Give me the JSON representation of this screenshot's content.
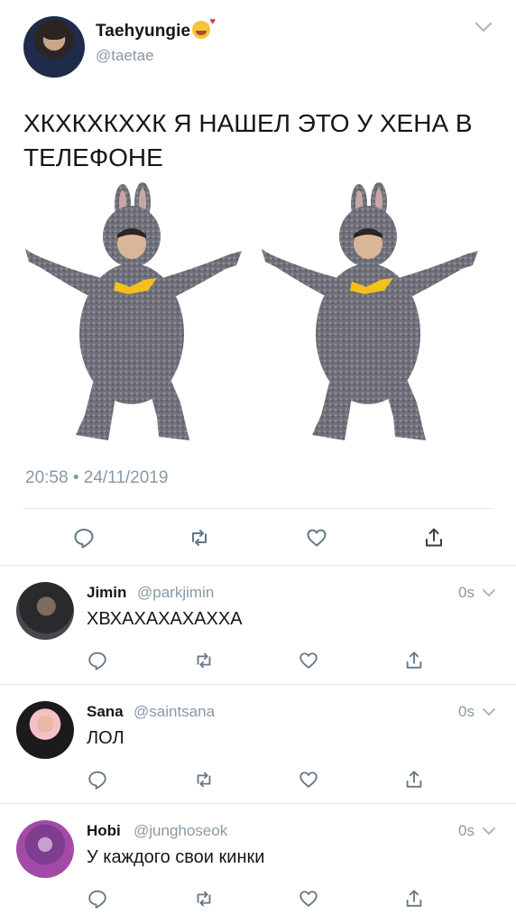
{
  "main_tweet": {
    "display_name": "Taehyungie",
    "emoji_icon": "smiling-face-with-hearts-icon",
    "handle": "@taetae",
    "text": "ХКХКХКХХК Я НАШЕЛ ЭТО У ХЕНА В ТЕЛЕФОНЕ",
    "timestamp": "20:58 • 24/11/2019",
    "media_description_icon": "bunny-costume-photo"
  },
  "replies": [
    {
      "display_name": "Jimin",
      "handle": "@parkjimin",
      "time": "0s",
      "text": "ХВХАХАХАХАХХА"
    },
    {
      "display_name": "Sana",
      "handle": "@saintsana",
      "time": "0s",
      "text": "ЛОЛ"
    },
    {
      "display_name": "Hobi",
      "handle": "@junghoseok",
      "time": "0s",
      "text": "У каждого свои кинки"
    }
  ],
  "icons": {
    "reply": "reply-icon",
    "retweet": "retweet-icon",
    "like": "heart-icon",
    "share": "share-icon",
    "menu": "chevron-down-icon"
  },
  "colors": {
    "text_primary": "#14171a",
    "text_secondary": "#8899a6",
    "divider": "#e1e8ed",
    "icon_gray": "#657786"
  }
}
